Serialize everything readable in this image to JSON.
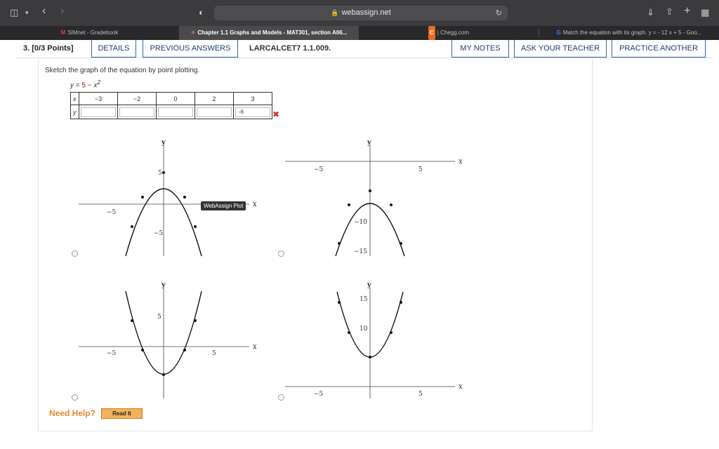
{
  "browser": {
    "url": "webassign.net",
    "tabs": [
      {
        "label": "SIMnet - Gradebook",
        "favicon": "M"
      },
      {
        "label": "Chapter 1.1 Graphs and Models - MAT301, section A06...",
        "favicon": "✳"
      },
      {
        "label": "| Chegg.com",
        "favicon": "C"
      },
      {
        "label": "Match the equation with its graph. y = - 12 x + 5 - Goo...",
        "favicon": "G"
      }
    ],
    "active_tab": 1
  },
  "question": {
    "number": "3.",
    "points": "[0/3 Points]",
    "buttons": {
      "details": "DETAILS",
      "previous": "PREVIOUS ANSWERS",
      "notes": "MY NOTES",
      "ask": "ASK YOUR TEACHER",
      "practice": "PRACTICE ANOTHER"
    },
    "reference": "LARCALCET7 1.1.009.",
    "prompt": "Sketch the graph of the equation by point plotting.",
    "equation": {
      "lhs": "y = ",
      "five": "5",
      "rest": " − x",
      "sup": "2"
    },
    "table": {
      "x_label": "x",
      "y_label": "y",
      "x_values": [
        "−3",
        "−2",
        "0",
        "2",
        "3"
      ],
      "y_values": [
        "",
        "",
        "",
        "",
        "-6"
      ],
      "status_mark": "✖"
    },
    "tooltip": "WebAssign Plot",
    "graphs": {
      "a": {
        "y_label": "y",
        "x_label": "x",
        "x_tick": "−5",
        "y_tick_top": "5",
        "y_tick_bottom": "−5"
      },
      "b": {
        "y_label": "y",
        "x_label": "x",
        "x_tick_left": "−5",
        "x_tick_right": "5",
        "y_tick_a": "−10",
        "y_tick_b": "−15"
      },
      "c": {
        "y_label": "y",
        "x_label": "x",
        "x_tick_left": "−5",
        "x_tick_right": "5",
        "y_tick_top": "5"
      },
      "d": {
        "y_label": "y",
        "x_label": "x",
        "x_tick_left": "−5",
        "x_tick_right": "5",
        "y_tick_a": "15",
        "y_tick_b": "10"
      }
    },
    "help": {
      "need_help": "Need Help?",
      "read_it": "Read It"
    }
  },
  "colors": {
    "accent_blue": "#2b67a6",
    "incorrect_red": "#d32f2f",
    "help_orange": "#e6892b"
  }
}
